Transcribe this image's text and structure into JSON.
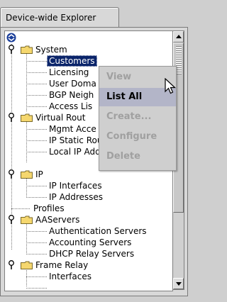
{
  "tab": {
    "label": "Device-wide Explorer"
  },
  "tree": {
    "items": [
      {
        "label": "System",
        "selected": false
      },
      {
        "label": "Customers",
        "selected": true
      },
      {
        "label": "Licensing",
        "selected": false
      },
      {
        "label": "User Doma",
        "selected": false
      },
      {
        "label": "BGP Neigh",
        "selected": false
      },
      {
        "label": "Access Lis",
        "selected": false
      },
      {
        "label": "Virtual Rout",
        "selected": false
      },
      {
        "label": "Mgmt Acce",
        "selected": false
      },
      {
        "label": "IP Static Routes",
        "selected": false
      },
      {
        "label": "Local IP Address Pools",
        "selected": false
      },
      {
        "label": "IP",
        "selected": false
      },
      {
        "label": "IP Interfaces",
        "selected": false
      },
      {
        "label": "IP Addresses",
        "selected": false
      },
      {
        "label": "Profiles",
        "selected": false
      },
      {
        "label": "AAServers",
        "selected": false
      },
      {
        "label": "Authentication Servers",
        "selected": false
      },
      {
        "label": "Accounting Servers",
        "selected": false
      },
      {
        "label": "DHCP Relay Servers",
        "selected": false
      },
      {
        "label": "Frame Relay",
        "selected": false
      },
      {
        "label": "Interfaces",
        "selected": false
      }
    ]
  },
  "context_menu": {
    "items": [
      {
        "label": "View",
        "enabled": false
      },
      {
        "label": "List All",
        "enabled": true,
        "highlighted": true
      },
      {
        "label": "Create...",
        "enabled": false
      },
      {
        "label": "Configure",
        "enabled": false
      },
      {
        "label": "Delete",
        "enabled": false
      }
    ]
  },
  "colors": {
    "selection": "#0a246a",
    "folder": "#f5d76e",
    "menu_highlight": "#b3b5c8",
    "disabled_text": "#a0a0a0"
  }
}
